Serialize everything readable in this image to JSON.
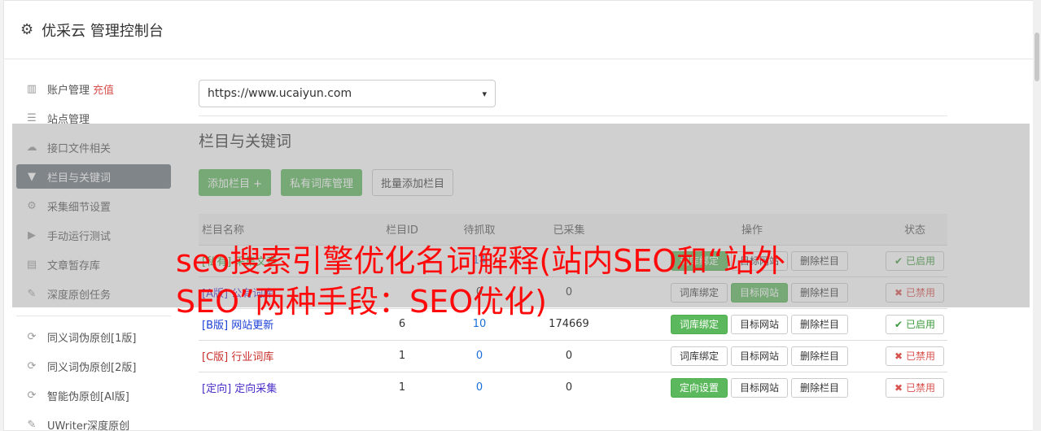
{
  "header": {
    "title": "优采云 管理控制台",
    "icon": "gear-icon"
  },
  "sidebar": {
    "items": [
      {
        "label": "账户管理",
        "extra": "充值",
        "icon": "bar-chart-icon"
      },
      {
        "label": "站点管理",
        "icon": "server-icon"
      },
      {
        "label": "接口文件相关",
        "icon": "cloud-upload-icon"
      },
      {
        "label": "栏目与关键词",
        "icon": "filter-icon",
        "active": true
      },
      {
        "label": "采集细节设置",
        "icon": "gears-icon"
      },
      {
        "label": "手动运行测试",
        "icon": "play-icon"
      },
      {
        "label": "文章暂存库",
        "icon": "database-icon"
      },
      {
        "label": "深度原创任务",
        "icon": "edit-icon"
      }
    ],
    "items2": [
      {
        "label": "同义词伪原创[1版]",
        "icon": "refresh-icon"
      },
      {
        "label": "同义词伪原创[2版]",
        "icon": "refresh-icon"
      },
      {
        "label": "智能伪原创[AI版]",
        "icon": "refresh-icon"
      },
      {
        "label": "UWriter深度原创",
        "icon": "edit-icon"
      }
    ]
  },
  "main": {
    "site_select": "https://www.ucaiyun.com",
    "section_title": "栏目与关键词",
    "buttons": {
      "add": "添加栏目 +",
      "private_lib": "私有词库管理",
      "batch_add": "批量添加栏目"
    },
    "table": {
      "headers": {
        "name": "栏目名称",
        "id": "栏目ID",
        "wait": "待抓取",
        "done": "已采集",
        "ops": "操作",
        "status": "状态"
      },
      "rows": [
        {
          "prefix": "[私有]",
          "name": "采集文章",
          "id": "",
          "wait": "14",
          "done": "",
          "op1": "词库绑定",
          "op2": "目标网站",
          "op3": "删除栏目",
          "status": "已启用"
        },
        {
          "prefix": "[A版]",
          "name": "公有词库",
          "id": "",
          "wait": "0",
          "done": "0",
          "op1": "词库绑定",
          "op2": "目标网站",
          "op3": "删除栏目",
          "status": "已禁用"
        },
        {
          "prefix": "[B版]",
          "name": "网站更新",
          "id": "6",
          "wait": "10",
          "done": "174669",
          "op1": "词库绑定",
          "op2": "目标网站",
          "op3": "删除栏目",
          "status": "已启用"
        },
        {
          "prefix": "[C版]",
          "name": "行业词库",
          "id": "1",
          "wait": "0",
          "done": "0",
          "op1": "词库绑定",
          "op2": "目标网站",
          "op3": "删除栏目",
          "status": "已禁用"
        },
        {
          "prefix": "[定向]",
          "name": "定向采集",
          "id": "1",
          "wait": "0",
          "done": "0",
          "op1": "定向设置",
          "op2": "目标网站",
          "op3": "删除栏目",
          "status": "已禁用"
        }
      ]
    }
  },
  "banner": "seo搜索引擎优化名词解释(站内SEO和“站外SEO”两种手段：SEO优化)"
}
